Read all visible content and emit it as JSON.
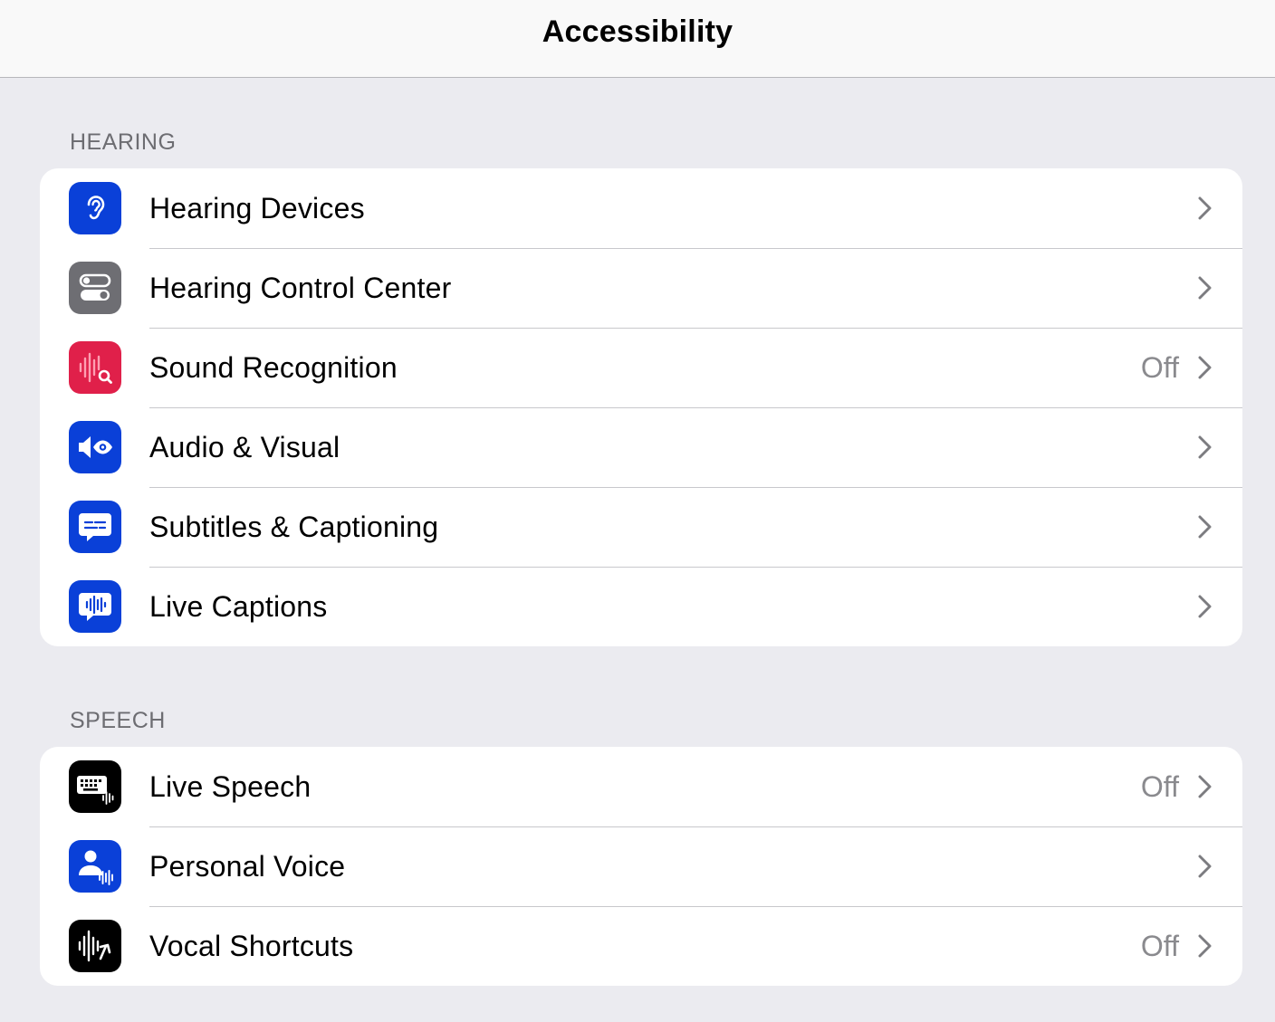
{
  "nav": {
    "title": "Accessibility"
  },
  "sections": {
    "hearing": {
      "header": "HEARING",
      "items": [
        {
          "label": "Hearing Devices",
          "value": "",
          "icon": "ear-icon",
          "color": "#0a40d8"
        },
        {
          "label": "Hearing Control Center",
          "value": "",
          "icon": "toggles-icon",
          "color": "#6e6e73"
        },
        {
          "label": "Sound Recognition",
          "value": "Off",
          "icon": "waveform-search-icon",
          "color": "#e0204a"
        },
        {
          "label": "Audio & Visual",
          "value": "",
          "icon": "speaker-eye-icon",
          "color": "#0a40d8"
        },
        {
          "label": "Subtitles & Captioning",
          "value": "",
          "icon": "caption-bubble-icon",
          "color": "#0a40d8"
        },
        {
          "label": "Live Captions",
          "value": "",
          "icon": "live-caption-bubble-icon",
          "color": "#0a40d8"
        }
      ]
    },
    "speech": {
      "header": "SPEECH",
      "items": [
        {
          "label": "Live Speech",
          "value": "Off",
          "icon": "keyboard-waveform-icon",
          "color": "#000000"
        },
        {
          "label": "Personal Voice",
          "value": "",
          "icon": "person-waveform-icon",
          "color": "#0a40d8"
        },
        {
          "label": "Vocal Shortcuts",
          "value": "Off",
          "icon": "waveform-arrow-icon",
          "color": "#000000"
        }
      ]
    }
  },
  "colors": {
    "background": "#ebebf0",
    "nav_background": "#f9f9f9",
    "chevron": "#b0b0b5",
    "secondary_text": "#8a8a8e"
  }
}
